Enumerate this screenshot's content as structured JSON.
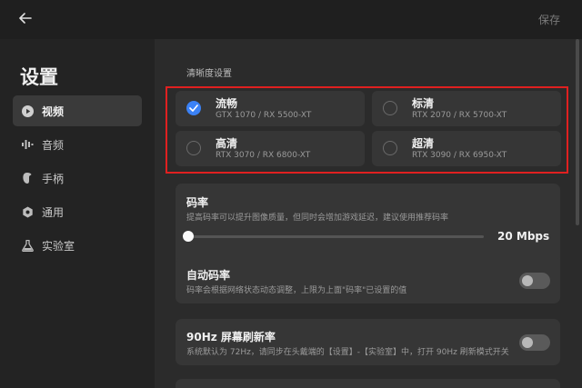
{
  "header": {
    "back_icon": "arrow-left-icon",
    "save_label": "保存"
  },
  "sidebar": {
    "title": "设置",
    "items": [
      {
        "label": "视频",
        "icon": "play-icon",
        "active": true
      },
      {
        "label": "音频",
        "icon": "audio-bars-icon",
        "active": false
      },
      {
        "label": "手柄",
        "icon": "gamepad-icon",
        "active": false
      },
      {
        "label": "通用",
        "icon": "gear-icon",
        "active": false
      },
      {
        "label": "实验室",
        "icon": "flask-icon",
        "active": false
      }
    ]
  },
  "quality": {
    "section_label": "清晰度设置",
    "options": [
      {
        "name": "流畅",
        "gpu": "GTX 1070 / RX 5500-XT",
        "selected": true
      },
      {
        "name": "标清",
        "gpu": "RTX 2070 / RX 5700-XT",
        "selected": false
      },
      {
        "name": "高清",
        "gpu": "RTX 3070 / RX 6800-XT",
        "selected": false
      },
      {
        "name": "超清",
        "gpu": "RTX 3090 / RX 6950-XT",
        "selected": false
      }
    ]
  },
  "bitrate": {
    "title": "码率",
    "desc": "提高码率可以提升图像质量，但同时会增加游戏延迟，建议使用推荐码率",
    "value_text": "20  Mbps",
    "slider_fraction": 0
  },
  "auto_bitrate": {
    "title": "自动码率",
    "desc": "码率会根据网络状态动态调整，上限为上面\"码率\"已设置的值",
    "enabled": false
  },
  "refresh": {
    "title": "90Hz 屏幕刷新率",
    "desc": "系统默认为 72Hz，请同步在头戴端的【设置】-【实验室】中，打开 90Hz 刷新模式开关",
    "enabled": false
  },
  "colors": {
    "accent": "#3b82f6",
    "highlight_border": "#e02020"
  }
}
